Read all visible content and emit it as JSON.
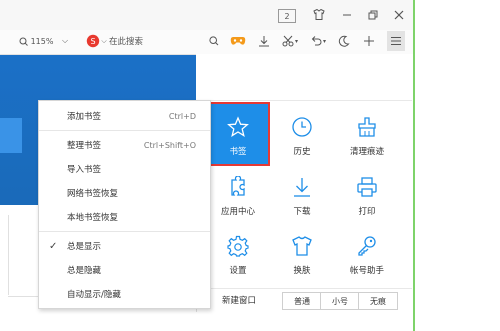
{
  "titlebar": {
    "tab_count": "2"
  },
  "toolbar": {
    "zoom": "115%",
    "search_placeholder": "在此搜索"
  },
  "bookmark_menu": {
    "items": [
      {
        "label": "添加书签",
        "shortcut": "Ctrl+D"
      },
      {
        "label": "整理书签",
        "shortcut": "Ctrl+Shift+O"
      },
      {
        "label": "导入书签",
        "shortcut": ""
      },
      {
        "label": "网络书签恢复",
        "shortcut": ""
      },
      {
        "label": "本地书签恢复",
        "shortcut": ""
      },
      {
        "label": "总是显示",
        "shortcut": "",
        "checked": true
      },
      {
        "label": "总是隐藏",
        "shortcut": ""
      },
      {
        "label": "自动显示/隐藏",
        "shortcut": ""
      }
    ]
  },
  "main_menu": {
    "grid": [
      {
        "label": "书签",
        "icon": "star-icon"
      },
      {
        "label": "历史",
        "icon": "clock-icon"
      },
      {
        "label": "清理痕迹",
        "icon": "broom-icon"
      },
      {
        "label": "应用中心",
        "icon": "puzzle-icon"
      },
      {
        "label": "下载",
        "icon": "download-icon"
      },
      {
        "label": "打印",
        "icon": "printer-icon"
      },
      {
        "label": "设置",
        "icon": "gear-icon"
      },
      {
        "label": "换肤",
        "icon": "tshirt-icon"
      },
      {
        "label": "帐号助手",
        "icon": "key-icon"
      }
    ],
    "new_window_label": "新建窗口",
    "modes": [
      "普通",
      "小号",
      "无痕"
    ]
  },
  "colors": {
    "accent": "#1e8ee8",
    "highlight_border": "#e53935",
    "frame": "#7ed36a"
  }
}
